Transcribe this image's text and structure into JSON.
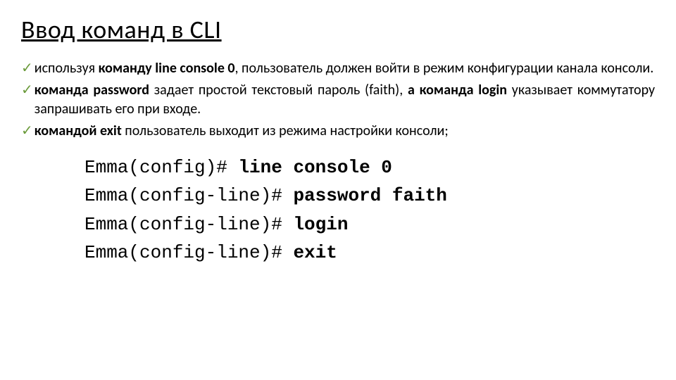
{
  "title": "Ввод команд в CLI",
  "bullets": {
    "b1": {
      "p1": "используя ",
      "bold1": "команду line console 0",
      "p2": ", пользователь должен войти в режим конфигурации канала консоли."
    },
    "b2": {
      "bold1": "команда password",
      "p1": " задает простой текстовый пароль (faith), ",
      "bold2": "а команда login",
      "p2": " указывает коммутатору запрашивать его при входе."
    },
    "b3": {
      "bold1": "командой exit",
      "p1": " пользователь выходит из режима настройки консоли;"
    }
  },
  "checkmark": "✓",
  "terminal": {
    "lines": [
      {
        "prompt": "Emma(config)# ",
        "cmd": "line console 0"
      },
      {
        "prompt": "Emma(config-line)# ",
        "cmd": "password faith"
      },
      {
        "prompt": "Emma(config-line)# ",
        "cmd": "login"
      },
      {
        "prompt": "Emma(config-line)# ",
        "cmd": "exit"
      }
    ]
  }
}
